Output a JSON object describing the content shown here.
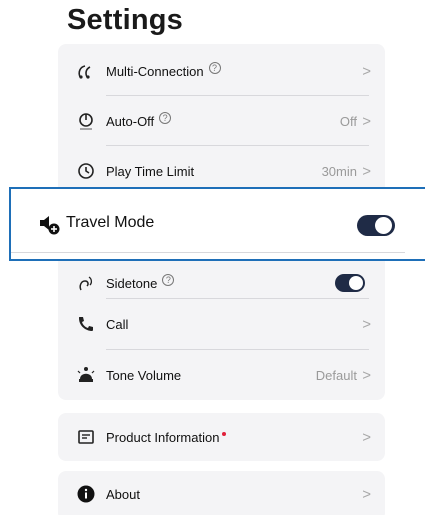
{
  "page": {
    "title": "Settings"
  },
  "main_card": {
    "multi_connection": {
      "label": "Multi-Connection",
      "help": "?"
    },
    "auto_off": {
      "label": "Auto-Off",
      "help": "?",
      "value": "Off"
    },
    "play_time_limit": {
      "label": "Play Time Limit",
      "value": "30min"
    },
    "travel_mode": {
      "label": "Travel Mode",
      "enabled": true
    },
    "sidetone": {
      "label": "Sidetone",
      "help": "?",
      "enabled": true
    },
    "call": {
      "label": "Call"
    },
    "tone_volume": {
      "label": "Tone Volume",
      "value": "Default"
    }
  },
  "product_information": {
    "label": "Product Information"
  },
  "about": {
    "label": "About"
  },
  "chevron": ">",
  "colors": {
    "highlight_border": "#1e6fb8",
    "toggle_on": "#1f2b46",
    "notification_dot": "#e0203a"
  },
  "icons": {
    "multi_connection": "multi-connection-icon",
    "auto_off": "auto-off-icon",
    "play_time_limit": "timer-icon",
    "travel_mode": "speaker-plus-icon",
    "sidetone": "sidetone-icon",
    "call": "phone-icon",
    "tone_volume": "tone-volume-icon",
    "product_information": "product-info-icon",
    "about": "info-icon"
  }
}
